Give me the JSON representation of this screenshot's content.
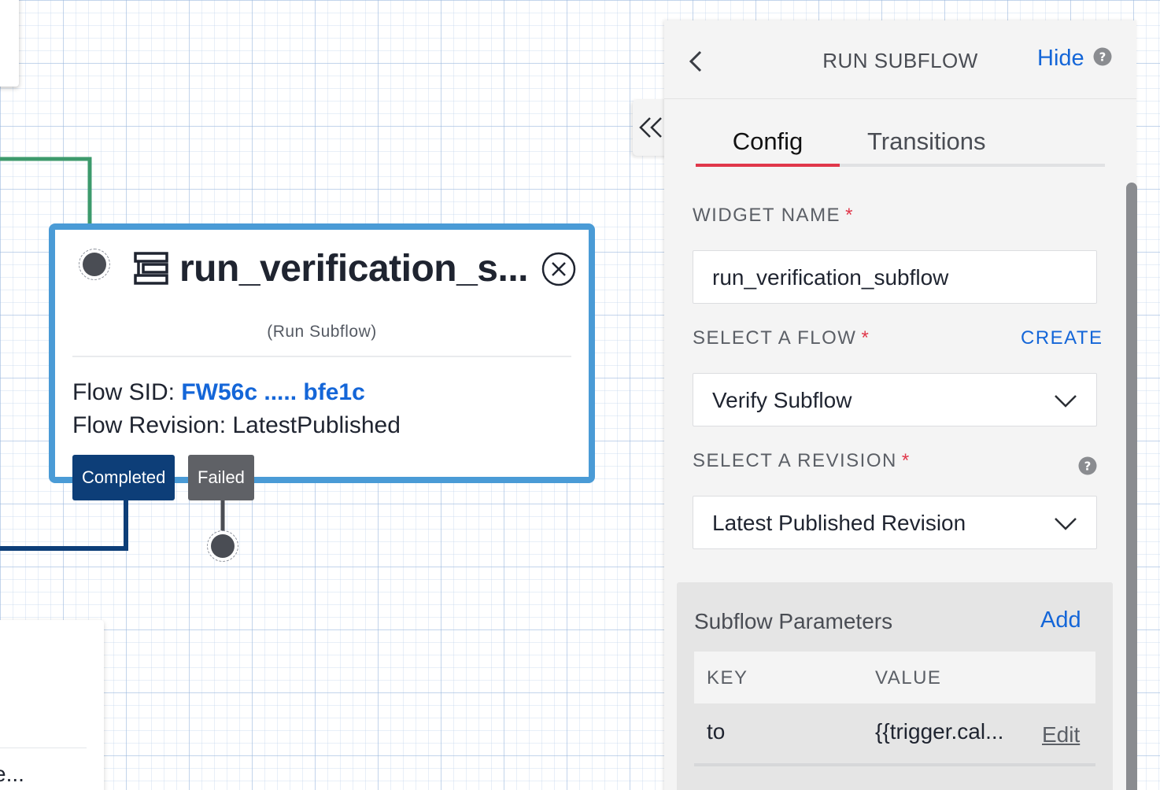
{
  "canvas": {
    "bottom_card_text": "e...",
    "widget": {
      "title": "run_verification_s...",
      "type_label": "(Run Subflow)",
      "flow_sid_label": "Flow SID: ",
      "flow_sid_value": "FW56c ..... bfe1c",
      "flow_revision_label": "Flow Revision: ",
      "flow_revision_value": "LatestPublished",
      "transitions": [
        "Completed",
        "Failed"
      ]
    }
  },
  "panel": {
    "title": "RUN SUBFLOW",
    "hide_label": "Hide",
    "tabs": [
      {
        "label": "Config",
        "active": true
      },
      {
        "label": "Transitions",
        "active": false
      }
    ],
    "widget_name": {
      "label": "WIDGET NAME",
      "required_mark": "*",
      "value": "run_verification_subflow"
    },
    "select_flow": {
      "label": "SELECT A FLOW",
      "required_mark": "*",
      "action_label": "CREATE",
      "value": "Verify Subflow"
    },
    "select_revision": {
      "label": "SELECT A REVISION",
      "required_mark": "*",
      "value": "Latest Published Revision"
    },
    "subflow_parameters": {
      "title": "Subflow Parameters",
      "add_label": "Add",
      "columns": [
        "KEY",
        "VALUE"
      ],
      "rows": [
        {
          "key": "to",
          "value": "{{trigger.cal...",
          "action": "Edit"
        }
      ]
    }
  },
  "colors": {
    "accent_blue": "#1466d8",
    "widget_border": "#4a9bd6",
    "completed_tag": "#0d3e78",
    "failed_tag": "#5f6166",
    "required_red": "#e0374a",
    "success_wire": "#3d9a6c"
  },
  "icons": {
    "widget_type": "run-subflow-icon",
    "widget_close": "close-circle-icon",
    "panel_back": "chevron-left-icon",
    "panel_help": "question-circle-icon",
    "collapse": "double-chevron-left-icon",
    "dropdown": "chevron-down-icon"
  }
}
